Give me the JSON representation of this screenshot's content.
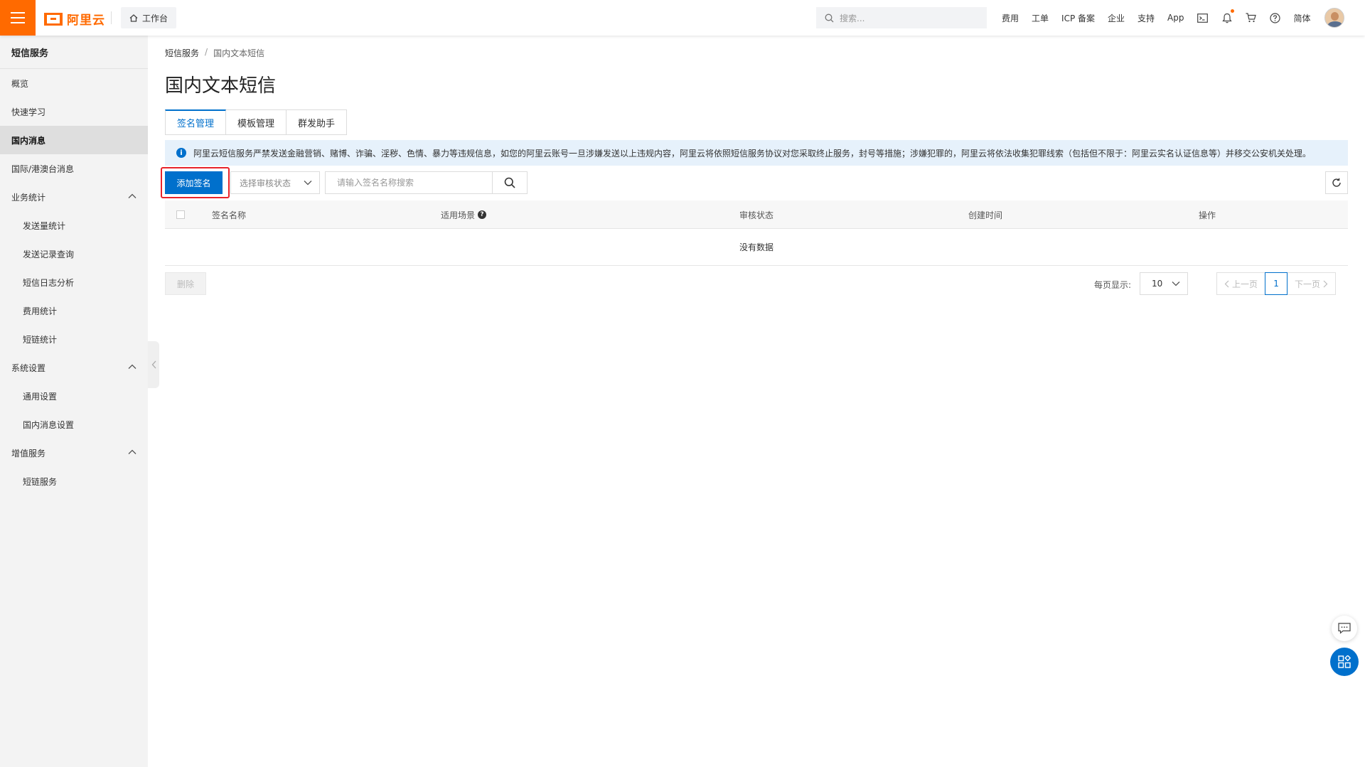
{
  "header": {
    "logo_text": "阿里云",
    "workbench_label": "工作台",
    "search_placeholder": "搜索...",
    "nav": [
      "费用",
      "工单",
      "ICP 备案",
      "企业",
      "支持",
      "App"
    ],
    "language": "简体",
    "accent_color": "#ff6a00"
  },
  "sidebar": {
    "title": "短信服务",
    "items": [
      {
        "label": "概览"
      },
      {
        "label": "快速学习"
      },
      {
        "label": "国内消息"
      },
      {
        "label": "国际/港澳台消息"
      },
      {
        "label": "业务统计"
      },
      {
        "label": "发送量统计"
      },
      {
        "label": "发送记录查询"
      },
      {
        "label": "短信日志分析"
      },
      {
        "label": "费用统计"
      },
      {
        "label": "短链统计"
      },
      {
        "label": "系统设置"
      },
      {
        "label": "通用设置"
      },
      {
        "label": "国内消息设置"
      },
      {
        "label": "增值服务"
      },
      {
        "label": "短链服务"
      }
    ]
  },
  "breadcrumb": {
    "root": "短信服务",
    "sep": "/",
    "current": "国内文本短信"
  },
  "page_title": "国内文本短信",
  "tabs": [
    {
      "label": "签名管理"
    },
    {
      "label": "模板管理"
    },
    {
      "label": "群发助手"
    }
  ],
  "notice": "阿里云短信服务严禁发送金融营销、赌博、诈骗、淫秽、色情、暴力等违规信息，如您的阿里云账号一旦涉嫌发送以上违规内容，阿里云将依照短信服务协议对您采取终止服务，封号等措施；涉嫌犯罪的，阿里云将依法收集犯罪线索（包括但不限于：阿里云实名认证信息等）并移交公安机关处理。",
  "toolbar": {
    "add_label": "添加签名",
    "status_placeholder": "选择审核状态",
    "search_placeholder": "请输入签名名称搜索"
  },
  "table": {
    "columns": [
      "签名名称",
      "适用场景",
      "审核状态",
      "创建时间",
      "操作"
    ],
    "empty_text": "没有数据"
  },
  "footer": {
    "delete_label": "删除",
    "page_size_label": "每页显示:",
    "page_size": "10",
    "prev_label": "上一页",
    "current_page": "1",
    "next_label": "下一页"
  },
  "colors": {
    "primary": "#0070cc",
    "highlight_border": "#e8232a"
  }
}
